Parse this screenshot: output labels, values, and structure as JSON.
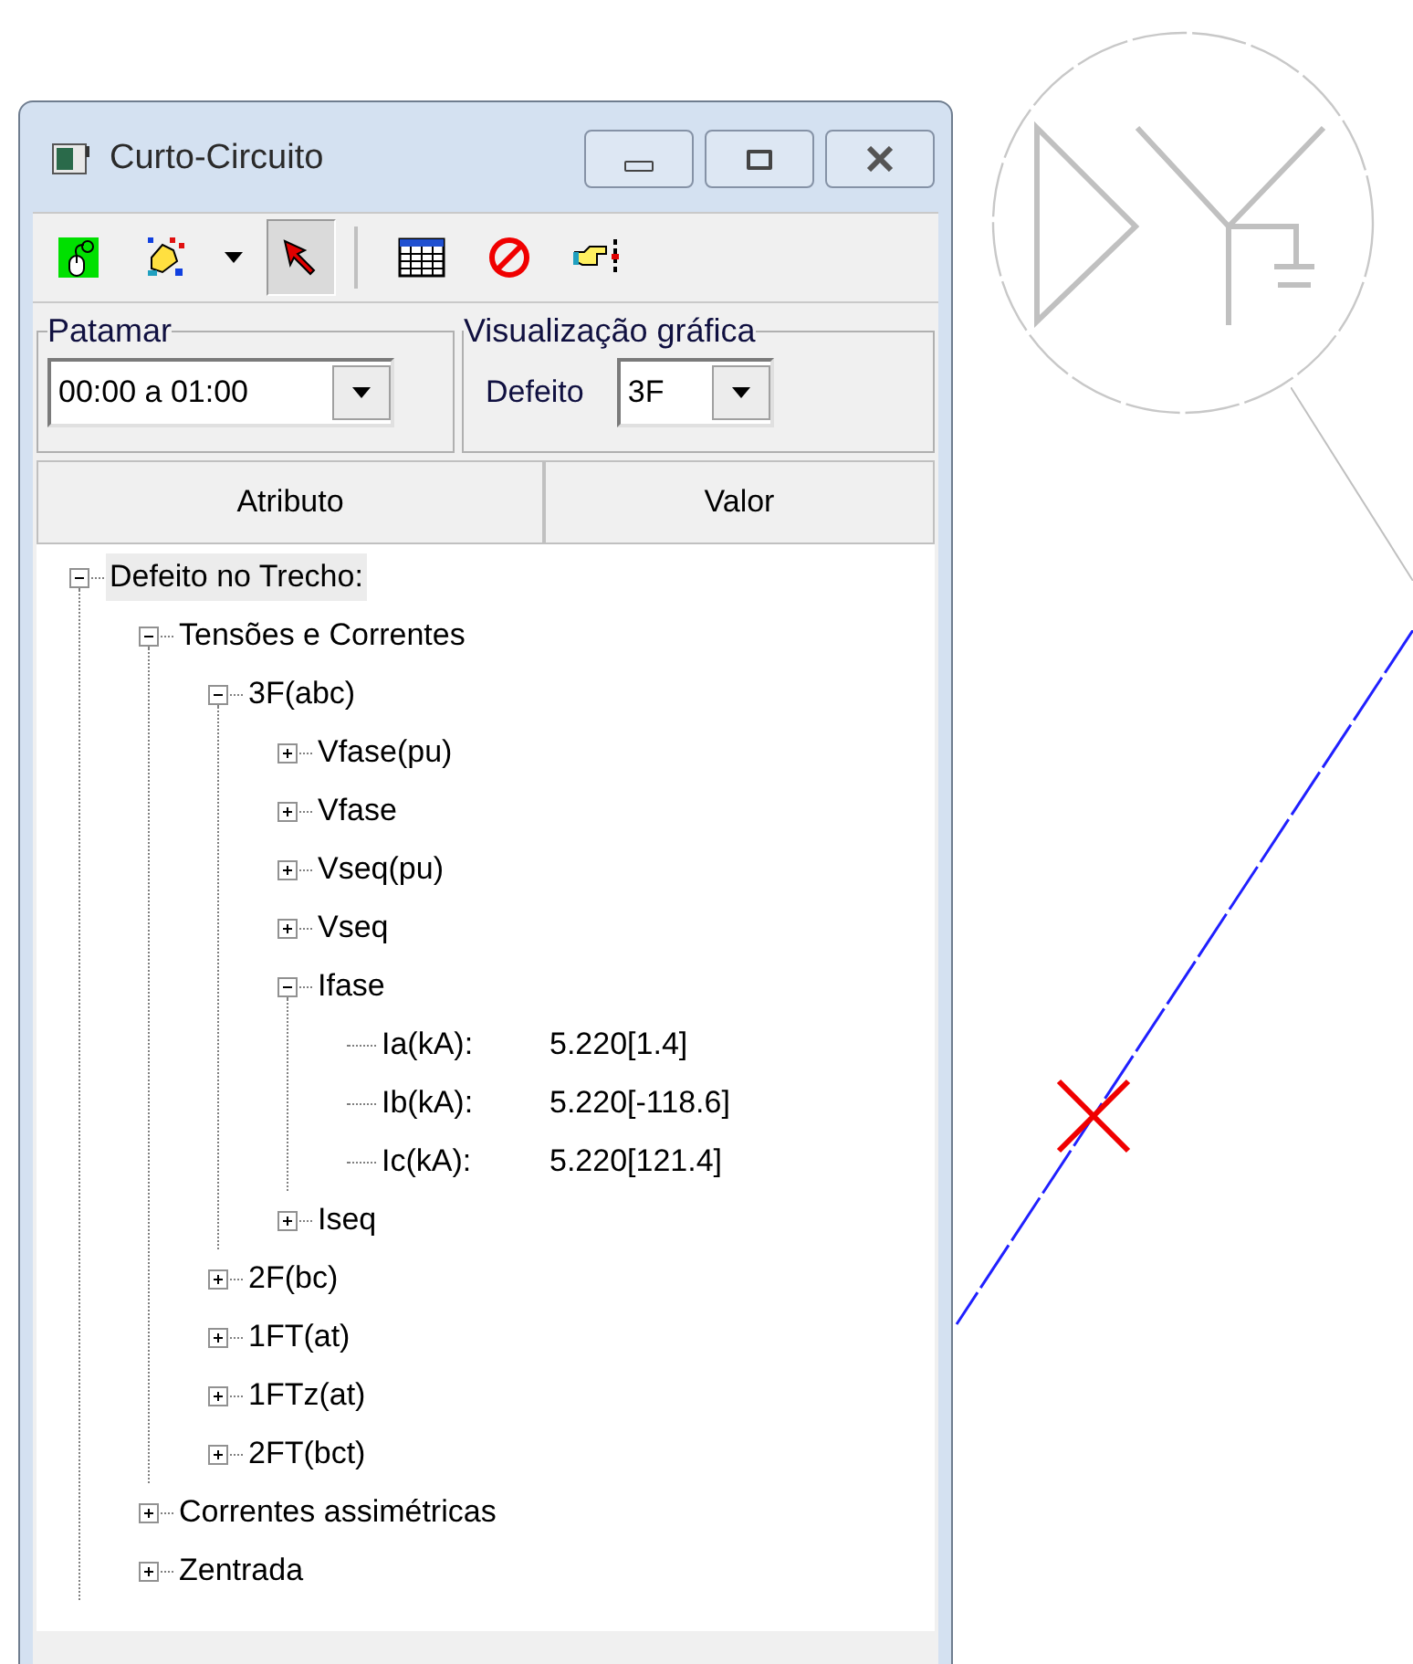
{
  "window": {
    "title": "Curto-Circuito"
  },
  "toolbar": [
    [
      {
        "kind": "mouse",
        "pressed": false
      },
      {
        "kind": "hand",
        "pressed": false
      },
      {
        "kind": "caret",
        "pressed": false
      },
      {
        "kind": "pointer",
        "pressed": true
      }
    ],
    [
      {
        "kind": "table",
        "pressed": false
      },
      {
        "kind": "stop",
        "pressed": false
      },
      {
        "kind": "point",
        "pressed": false
      }
    ]
  ],
  "patamar": {
    "label": "Patamar",
    "value": "00:00 a 01:00"
  },
  "visualizacao": {
    "label": "Visualização gráfica",
    "field_label": "Defeito",
    "value": "3F"
  },
  "columns": [
    "Atributo",
    "Valor"
  ],
  "tree": [
    {
      "label": "Defeito no Trecho:",
      "expanded": true,
      "selected": true,
      "children": [
        {
          "label": "Tensões e Correntes",
          "expanded": true,
          "selected": false,
          "children": [
            {
              "label": "3F(abc)",
              "expanded": true,
              "selected": false,
              "children": [
                {
                  "label": "Vfase(pu)",
                  "expanded": false,
                  "selected": false
                },
                {
                  "label": "Vfase",
                  "expanded": false,
                  "selected": false
                },
                {
                  "label": "Vseq(pu)",
                  "expanded": false,
                  "selected": false
                },
                {
                  "label": "Vseq",
                  "expanded": false,
                  "selected": false
                },
                {
                  "label": "Ifase",
                  "expanded": true,
                  "selected": false,
                  "children": [
                    {
                      "label": "Ia(kA):",
                      "value": "5.220[1.4]",
                      "selected": false
                    },
                    {
                      "label": "Ib(kA):",
                      "value": "5.220[-118.6]",
                      "selected": false
                    },
                    {
                      "label": "Ic(kA):",
                      "value": "5.220[121.4]",
                      "selected": false
                    }
                  ]
                },
                {
                  "label": "Iseq",
                  "expanded": false,
                  "selected": false
                }
              ]
            },
            {
              "label": "2F(bc)",
              "expanded": false,
              "selected": false
            },
            {
              "label": "1FT(at)",
              "expanded": false,
              "selected": false
            },
            {
              "label": "1FTz(at)",
              "expanded": false,
              "selected": false
            },
            {
              "label": "2FT(bct)",
              "expanded": false,
              "selected": false
            }
          ]
        },
        {
          "label": "Correntes assimétricas",
          "expanded": false,
          "selected": false
        },
        {
          "label": "Zentrada",
          "expanded": false,
          "selected": false
        }
      ]
    }
  ]
}
